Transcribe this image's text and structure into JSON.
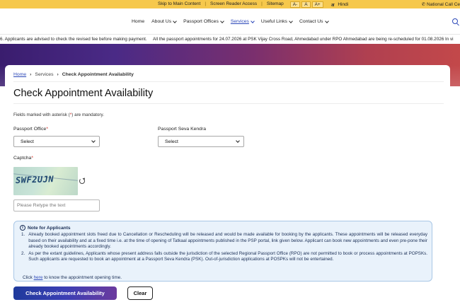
{
  "topbar": {
    "skip_main": "Skip to Main Content",
    "screen_reader": "Screen Reader Access",
    "sitemap": "Sitemap",
    "font_small": "A-",
    "font_normal": "A",
    "font_large": "A+",
    "hindi": "Hindi",
    "call_centre": "National Call Ce"
  },
  "nav": {
    "items": [
      {
        "label": "Home"
      },
      {
        "label": "About Us"
      },
      {
        "label": "Passport Offices"
      },
      {
        "label": "Services"
      },
      {
        "label": "Useful Links"
      },
      {
        "label": "Contact Us"
      }
    ]
  },
  "ticker": {
    "text1": "6. Applicants are advised to check the revised fee before making payment.",
    "text2": "All the passport appointments for 24.07.2026 at PSK Vijay Cross Road, Ahmedabad under RPO Ahmedabad are being re-scheduled for 01.08.2026 In vi"
  },
  "breadcrumb": {
    "home": "Home",
    "services": "Services",
    "current": "Check Appointment Availability"
  },
  "page": {
    "title": "Check Appointment Availability",
    "mandatory_pre": "Fields marked with asterisk (",
    "mandatory_star": "*",
    "mandatory_post": ") are mandatory."
  },
  "form": {
    "passport_office_label": "Passport Office",
    "passport_office_value": "Select",
    "psk_label": "Passport Seva Kendra",
    "psk_value": "Select",
    "captcha_label": "Captcha",
    "captcha_text": "SWF2UJN",
    "captcha_placeholder": "Please Retype the text",
    "required_mark": "*"
  },
  "note": {
    "heading": "Note for Applicants",
    "items": [
      {
        "num": "1.",
        "text": "Already booked appointment slots freed due to Cancellation or Rescheduling will be released and would be made available for booking by the applicants. These appointments will be released everyday based on their availability and at a fixed time i.e. at the time of opening of Tatkaal appointments published in the PSP portal, link given below. Applicant can book new appointments and even pre-pone their already booked appointments accordingly."
      },
      {
        "num": "2.",
        "text": "As per the extant guidelines, Applicants whose present address falls outside the jurisdiction of the selected Regional Passport Office (RPO) are not permitted to book or process appointments at POPSKs. Such applicants are requested to book an appointment at a Passport Seva Kendra (PSK). Out-of-jurisdiction applications at POSPKs will not be entertained."
      }
    ],
    "click_pre": "Click ",
    "click_link": "here",
    "click_post": " to know the appointment opening time."
  },
  "buttons": {
    "check": "Check Appointment Availability",
    "clear": "Clear"
  }
}
